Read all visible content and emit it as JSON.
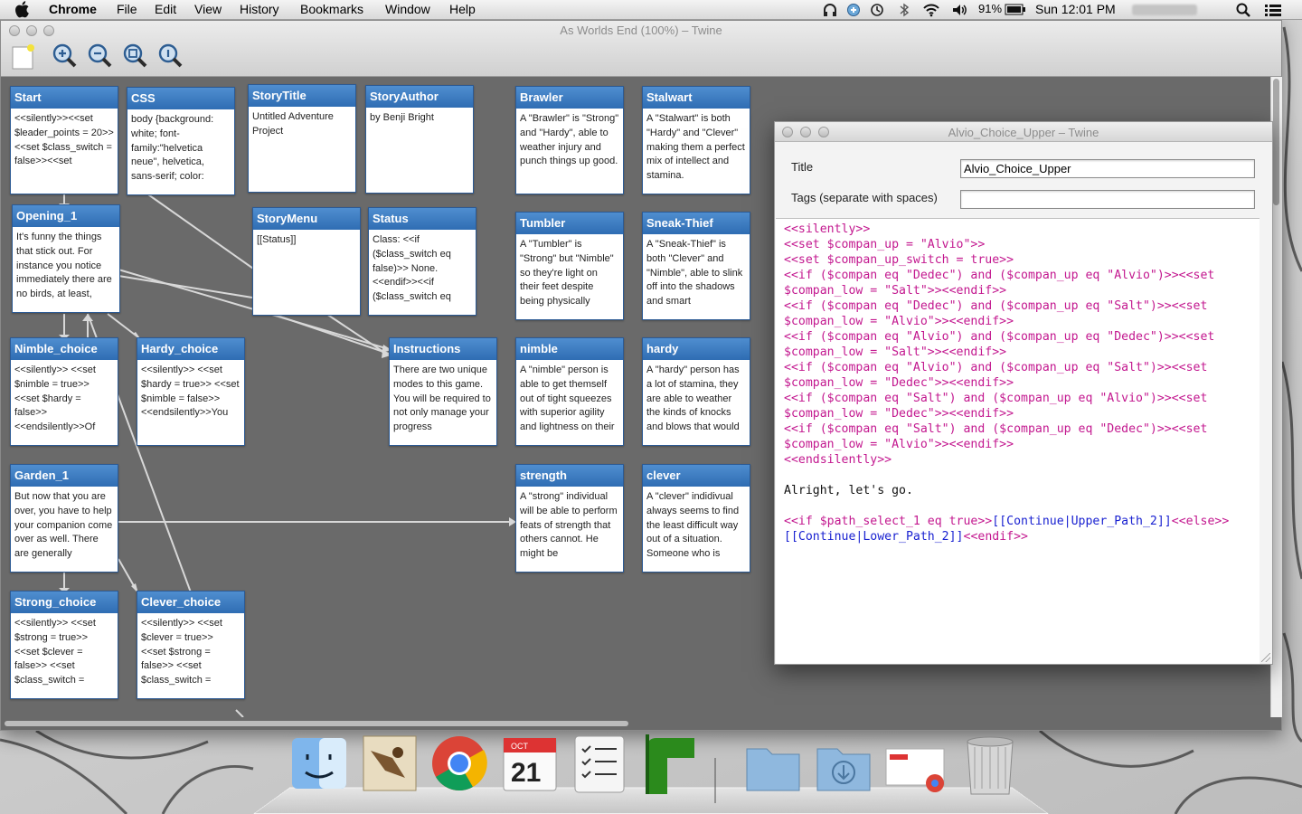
{
  "menubar": {
    "app": "Chrome",
    "items": [
      "File",
      "Edit",
      "View",
      "History",
      "Bookmarks",
      "Window",
      "Help"
    ],
    "battery": "91%",
    "clock": "Sun 12:01 PM"
  },
  "window": {
    "title": "As Worlds End (100%) – Twine",
    "toolbar": [
      "new-passage-icon",
      "zoom-in-icon",
      "zoom-out-icon",
      "zoom-fit-icon",
      "zoom-actual-icon"
    ]
  },
  "passages": [
    {
      "title": "Start",
      "body": "<<silently>><<set $leader_points = 20>><<set $class_switch = false>><<set"
    },
    {
      "title": "CSS",
      "body": "body {background: white; font-family:\"helvetica neue\", helvetica, sans-serif; color:"
    },
    {
      "title": "StoryTitle",
      "body": "Untitled Adventure Project"
    },
    {
      "title": "StoryAuthor",
      "body": "by Benji Bright"
    },
    {
      "title": "Brawler",
      "body": "A \"Brawler\" is \"Strong\" and \"Hardy\", able to weather injury and punch things up good."
    },
    {
      "title": "Stalwart",
      "body": "A \"Stalwart\" is both \"Hardy\" and \"Clever\" making them a perfect mix of intellect and stamina."
    },
    {
      "title": "Opening_1",
      "body": "It's funny the things that stick out. For instance you notice immediately there are no birds, at least,"
    },
    {
      "title": "StoryMenu",
      "body": "[[Status]]"
    },
    {
      "title": "Status",
      "body": "Class: <<if ($class_switch eq false)>> None. <<endif>><<if ($class_switch eq"
    },
    {
      "title": "Tumbler",
      "body": "A \"Tumbler\" is \"Strong\" but \"Nimble\" so they're light on their feet despite being physically"
    },
    {
      "title": "Sneak-Thief",
      "body": "A \"Sneak-Thief\" is both \"Clever\" and \"Nimble\", able to slink off into the shadows and smart"
    },
    {
      "title": "Nimble_choice",
      "body": "<<silently>> <<set $nimble = true>> <<set $hardy = false>> <<endsilently>>Of"
    },
    {
      "title": "Hardy_choice",
      "body": "<<silently>> <<set $hardy = true>> <<set $nimble = false>> <<endsilently>>You"
    },
    {
      "title": "Instructions",
      "body": "There are two unique modes to this game. You will be required to not only manage your progress"
    },
    {
      "title": "nimble",
      "body": "A \"nimble\" person is able to get themself out of tight squeezes with superior agility and lightness on their"
    },
    {
      "title": "hardy",
      "body": "A \"hardy\" person has a lot of stamina, they are able to weather the kinds of knocks and blows that would"
    },
    {
      "title": "Garden_1",
      "body": "But now that you are over, you have to help your companion come over as well. There are generally"
    },
    {
      "title": "strength",
      "body": "A \"strong\" individual will be able to perform feats of strength that others cannot. He might be"
    },
    {
      "title": "clever",
      "body": "A \"clever\" indidivual always seems to find the least difficult way out of a situation. Someone who is"
    },
    {
      "title": "Strong_choice",
      "body": "<<silently>> <<set $strong = true>> <<set $clever = false>> <<set $class_switch ="
    },
    {
      "title": "Clever_choice",
      "body": "<<silently>> <<set $clever = true>> <<set $strong = false>> <<set $class_switch ="
    }
  ],
  "editor": {
    "window_title": "Alvio_Choice_Upper – Twine",
    "title_label": "Title",
    "title_value": "Alvio_Choice_Upper",
    "tags_label": "Tags (separate with spaces)",
    "tags_value": "",
    "lines": [
      {
        "t": "<<silently>>",
        "c": "mac"
      },
      {
        "t": "<<set $compan_up = \"Alvio\">>",
        "c": "mac"
      },
      {
        "t": "<<set $compan_up_switch = true>>",
        "c": "mac"
      },
      {
        "t": "<<if ($compan eq \"Dedec\") and ($compan_up eq \"Alvio\")>><<set",
        "c": "mac"
      },
      {
        "t": "$compan_low = \"Salt\">><<endif>>",
        "c": "mac"
      },
      {
        "t": "<<if ($compan eq \"Dedec\") and ($compan_up eq \"Salt\")>><<set",
        "c": "mac"
      },
      {
        "t": "$compan_low = \"Alvio\">><<endif>>",
        "c": "mac"
      },
      {
        "t": "<<if ($compan eq \"Alvio\") and ($compan_up eq \"Dedec\")>><<set",
        "c": "mac"
      },
      {
        "t": "$compan_low = \"Salt\">><<endif>>",
        "c": "mac"
      },
      {
        "t": "<<if ($compan eq \"Alvio\") and ($compan_up eq \"Salt\")>><<set",
        "c": "mac"
      },
      {
        "t": "$compan_low = \"Dedec\">><<endif>>",
        "c": "mac"
      },
      {
        "t": "<<if ($compan eq \"Salt\") and ($compan_up eq \"Alvio\")>><<set",
        "c": "mac"
      },
      {
        "t": "$compan_low = \"Dedec\">><<endif>>",
        "c": "mac"
      },
      {
        "t": "<<if ($compan eq \"Salt\") and ($compan_up eq \"Dedec\")>><<set",
        "c": "mac"
      },
      {
        "t": "$compan_low = \"Alvio\">><<endif>>",
        "c": "mac"
      },
      {
        "t": "<<endsilently>>",
        "c": "mac"
      },
      {
        "t": "",
        "c": "txt"
      },
      {
        "t": "Alright, let's go.",
        "c": "txt"
      },
      {
        "t": "",
        "c": "txt"
      }
    ],
    "last_line": {
      "a": "<<if $path_select_1 eq true>>",
      "b": "[[Continue|Upper_Path_2]]",
      "c": "<<else>>",
      "d": "[[Continue|Lower_Path_2]]",
      "e": "<<endif>>"
    }
  },
  "dock": [
    "finder-icon",
    "mail-icon",
    "chrome-icon",
    "calendar-icon",
    "reminders-icon",
    "twine-icon",
    "folder-icon",
    "downloads-icon",
    "document-stack-icon",
    "trash-icon"
  ],
  "calendar": {
    "month": "OCT",
    "day": "21"
  }
}
